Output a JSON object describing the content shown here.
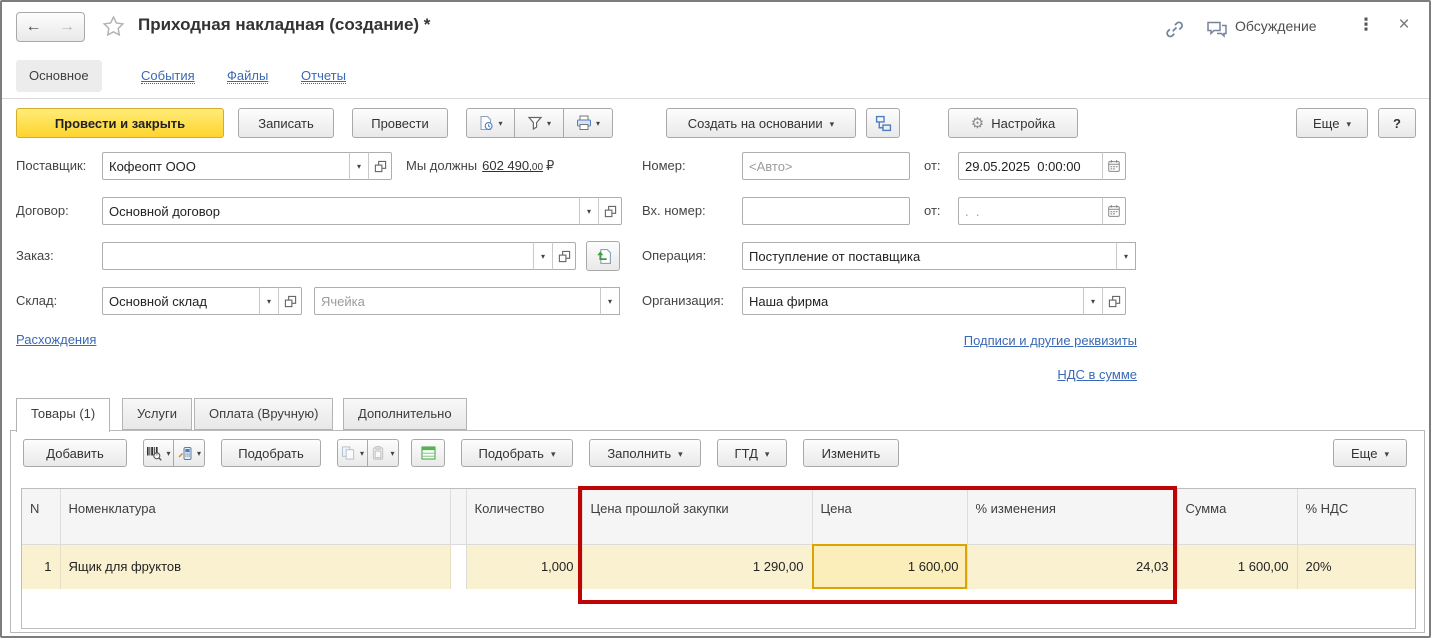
{
  "window": {
    "title": "Приходная накладная (создание) *",
    "discussion": "Обсуждение"
  },
  "icons": {
    "back_arrow": "←",
    "forward_arrow": "→",
    "kebab": "⋮",
    "close": "×",
    "gear": "⚙"
  },
  "nav_tabs": {
    "main": "Основное",
    "events": "События",
    "files": "Файлы",
    "reports": "Отчеты"
  },
  "toolbar": {
    "post_and_close": "Провести и закрыть",
    "save": "Записать",
    "post": "Провести",
    "create_based_on": "Создать на основании",
    "settings": "Настройка",
    "more": "Еще",
    "help": "?"
  },
  "form": {
    "supplier_label": "Поставщик:",
    "supplier_value": "Кофеопт ООО",
    "debt_prefix": "Мы должны",
    "debt_amount_main": "602 490",
    "debt_amount_frac": ",00",
    "debt_currency": "₽",
    "number_label": "Номер:",
    "number_placeholder": "<Авто>",
    "date_label": "от:",
    "date_value": "29.05.2025  0:00:00",
    "contract_label": "Договор:",
    "contract_value": "Основной договор",
    "incoming_number_label": "Вх. номер:",
    "incoming_date_label": "от:",
    "incoming_date_placeholder": ".  .",
    "order_label": "Заказ:",
    "operation_label": "Операция:",
    "operation_value": "Поступление от поставщика",
    "warehouse_label": "Склад:",
    "warehouse_value": "Основной склад",
    "cell_placeholder": "Ячейка",
    "organization_label": "Организация:",
    "organization_value": "Наша фирма"
  },
  "links": {
    "discrepancies": "Расхождения",
    "signatures": "Подписи и другие реквизиты",
    "vat": "НДС в сумме"
  },
  "doc_tabs": {
    "goods": "Товары (1)",
    "services": "Услуги",
    "payment": "Оплата (Вручную)",
    "additional": "Дополнительно"
  },
  "table_toolbar": {
    "add": "Добавить",
    "pick": "Подобрать",
    "pick_menu": "Подобрать",
    "fill": "Заполнить",
    "gtd": "ГТД",
    "edit": "Изменить",
    "more": "Еще"
  },
  "table": {
    "columns": {
      "n": "N",
      "item": "Номенклатура",
      "qty": "Количество",
      "last_price": "Цена прошлой закупки",
      "price": "Цена",
      "change": "% изменения",
      "sum": "Сумма",
      "vat": "% НДС"
    },
    "rows": [
      {
        "n": "1",
        "item": "Ящик для фруктов",
        "qty": "1,000",
        "last_price": "1 290,00",
        "price": "1 600,00",
        "change": "24,03",
        "sum": "1 600,00",
        "vat": "20%"
      }
    ]
  },
  "colors": {
    "accent_yellow": "#ffd42e",
    "link_blue": "#3b69b5",
    "annotation_red": "#be0404",
    "selected_row_bg": "#faf1d0",
    "selected_cell_border": "#dca400"
  }
}
